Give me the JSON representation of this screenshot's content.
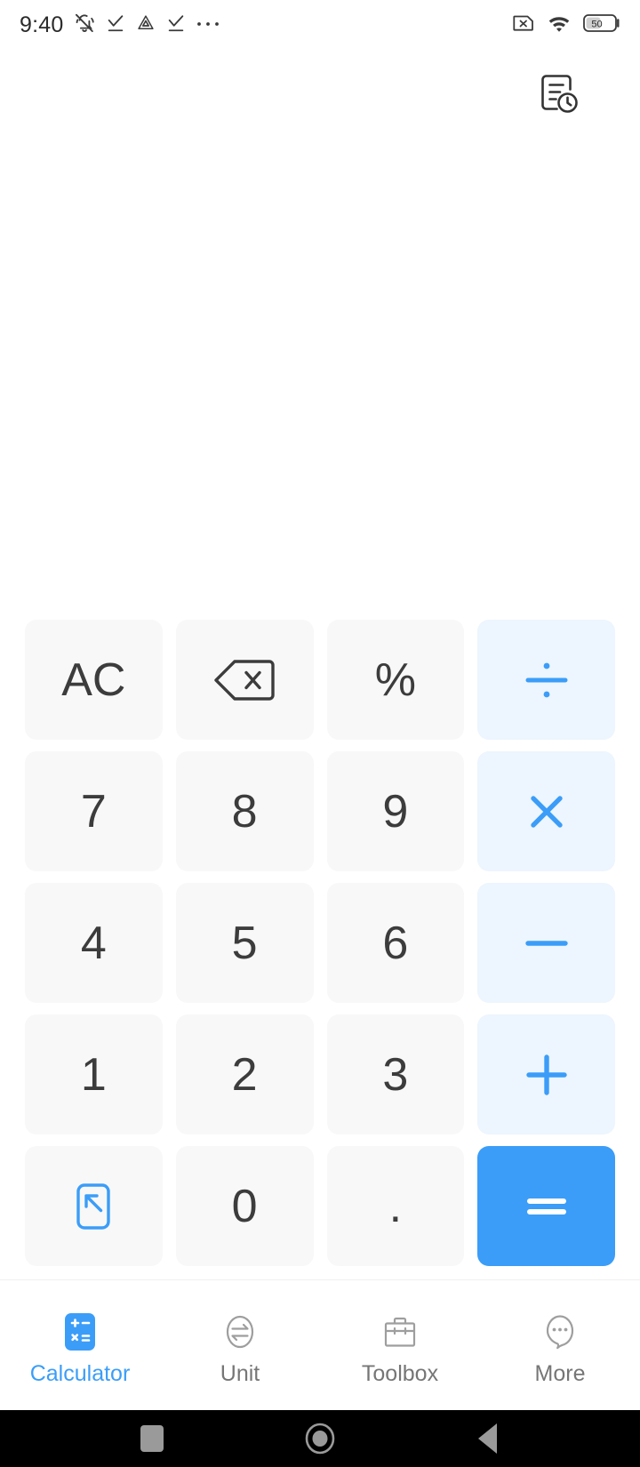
{
  "status_bar": {
    "time": "9:40",
    "left_icons": [
      "bell-mute-icon",
      "download-check-icon",
      "app-triangle-icon",
      "download-check-icon",
      "more-dots-icon"
    ],
    "right_icons": [
      "sim-no-card-icon",
      "wifi-icon",
      "battery-icon"
    ],
    "battery_level": "50"
  },
  "header": {
    "history_icon": "history-document-clock-icon"
  },
  "display": {
    "expression": "",
    "result": ""
  },
  "keypad": {
    "rows": [
      [
        {
          "label": "AC",
          "name": "key-all-clear",
          "kind": "fn",
          "icon": ""
        },
        {
          "label": "",
          "name": "key-backspace",
          "kind": "fn",
          "icon": "backspace-icon"
        },
        {
          "label": "%",
          "name": "key-percent",
          "kind": "fn",
          "icon": ""
        },
        {
          "label": "÷",
          "name": "key-divide",
          "kind": "op",
          "icon": "divide-icon"
        }
      ],
      [
        {
          "label": "7",
          "name": "key-7",
          "kind": "num",
          "icon": ""
        },
        {
          "label": "8",
          "name": "key-8",
          "kind": "num",
          "icon": ""
        },
        {
          "label": "9",
          "name": "key-9",
          "kind": "num",
          "icon": ""
        },
        {
          "label": "×",
          "name": "key-multiply",
          "kind": "op",
          "icon": "multiply-icon"
        }
      ],
      [
        {
          "label": "4",
          "name": "key-4",
          "kind": "num",
          "icon": ""
        },
        {
          "label": "5",
          "name": "key-5",
          "kind": "num",
          "icon": ""
        },
        {
          "label": "6",
          "name": "key-6",
          "kind": "num",
          "icon": ""
        },
        {
          "label": "−",
          "name": "key-subtract",
          "kind": "op",
          "icon": "minus-icon"
        }
      ],
      [
        {
          "label": "1",
          "name": "key-1",
          "kind": "num",
          "icon": ""
        },
        {
          "label": "2",
          "name": "key-2",
          "kind": "num",
          "icon": ""
        },
        {
          "label": "3",
          "name": "key-3",
          "kind": "num",
          "icon": ""
        },
        {
          "label": "+",
          "name": "key-add",
          "kind": "op",
          "icon": "plus-icon"
        }
      ],
      [
        {
          "label": "",
          "name": "key-expand-mode",
          "kind": "fn",
          "icon": "expand-landscape-icon"
        },
        {
          "label": "0",
          "name": "key-0",
          "kind": "num",
          "icon": ""
        },
        {
          "label": ".",
          "name": "key-decimal",
          "kind": "num",
          "icon": ""
        },
        {
          "label": "=",
          "name": "key-equals",
          "kind": "equals",
          "icon": "equals-icon"
        }
      ]
    ]
  },
  "tabbar": {
    "items": [
      {
        "label": "Calculator",
        "name": "tab-calculator",
        "icon": "calculator-icon",
        "active": true
      },
      {
        "label": "Unit",
        "name": "tab-unit",
        "icon": "unit-convert-icon",
        "active": false
      },
      {
        "label": "Toolbox",
        "name": "tab-toolbox",
        "icon": "briefcase-icon",
        "active": false
      },
      {
        "label": "More",
        "name": "tab-more",
        "icon": "more-bubble-icon",
        "active": false
      }
    ]
  },
  "system_nav": {
    "buttons": [
      "recents-square-icon",
      "home-circle-icon",
      "back-triangle-icon"
    ]
  },
  "colors": {
    "accent": "#3B9DF8",
    "operator_bg": "#EDF5FE",
    "key_bg": "#F8F8F9",
    "text": "#3C3C3C",
    "muted": "#767676"
  }
}
